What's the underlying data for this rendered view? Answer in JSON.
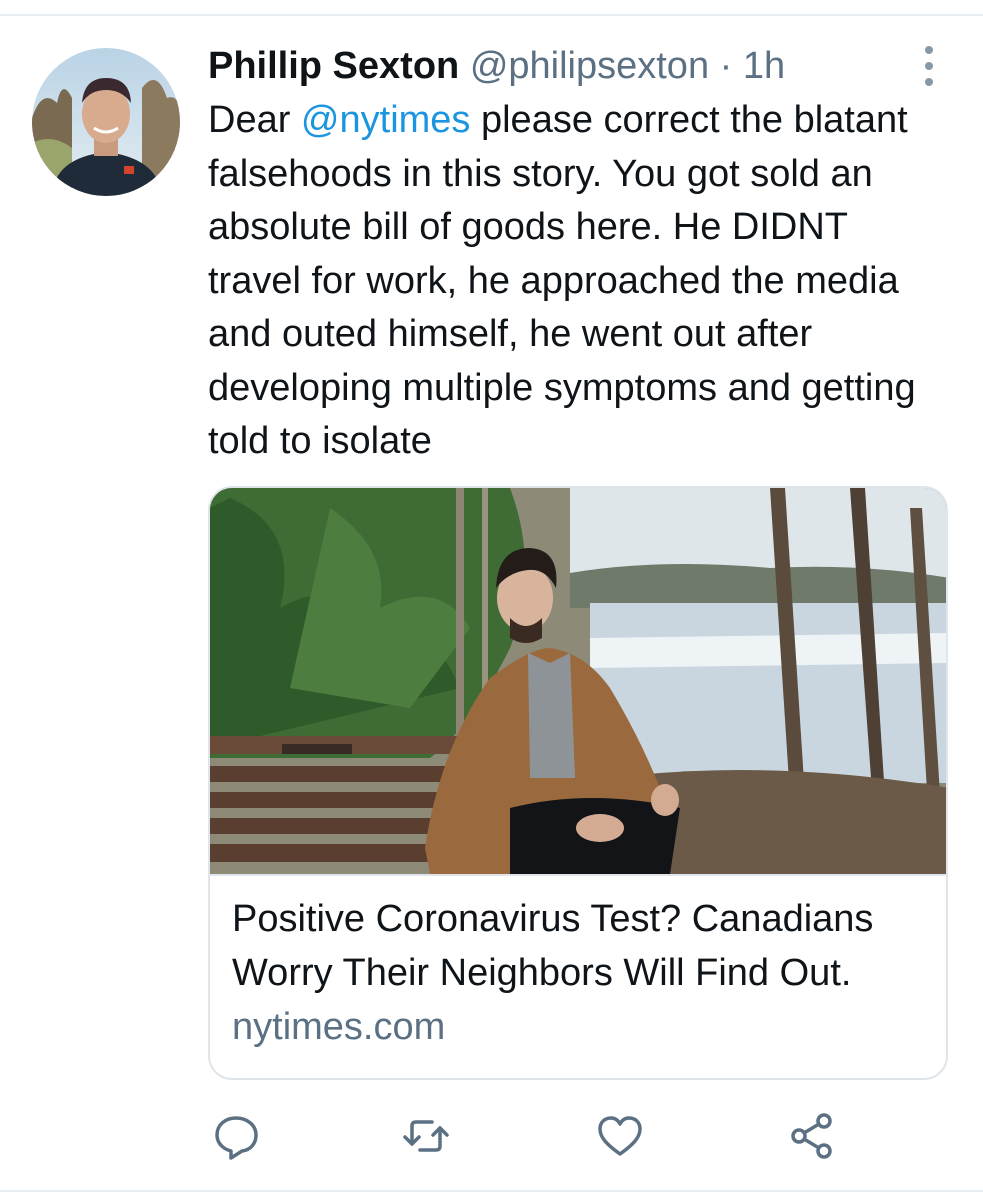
{
  "tweet": {
    "display_name": "Phillip Sexton",
    "handle": "@philipsexton",
    "separator": "·",
    "time": "1h",
    "text_before_mention": "Dear ",
    "mention": "@nytimes",
    "text_after_mention": " please correct the blatant falsehoods in this story. You got sold an absolute bill of goods here. He DIDNT travel for work, he approached the media and outed himself, he went out after developing multiple symptoms and getting told to isolate"
  },
  "card": {
    "title": "Positive Coronavirus Test? Canadians Worry Their Neighbors Will Find Out.",
    "domain": "nytimes.com"
  },
  "icons": {
    "more": "more-vertical-icon",
    "reply": "reply-icon",
    "retweet": "retweet-icon",
    "like": "heart-icon",
    "share": "share-icon"
  },
  "colors": {
    "link": "#1b95e0",
    "secondary_text": "#5b7083",
    "icon": "#5b7083",
    "border": "#dfe5ea"
  }
}
